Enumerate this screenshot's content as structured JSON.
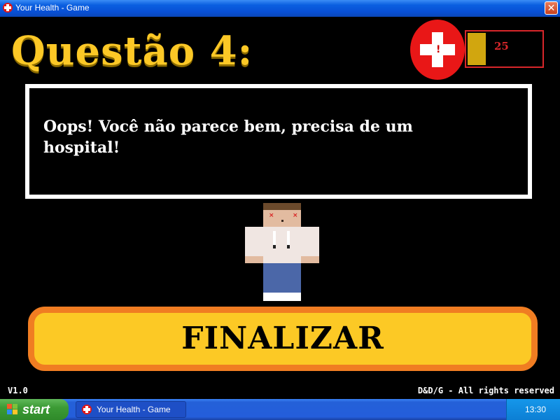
{
  "window": {
    "title": "Your Health - Game",
    "close_symbol": "✕"
  },
  "game": {
    "question_title": "Questão 4:",
    "health": {
      "value": "25",
      "level_percent": 25
    },
    "dialog_text": "Oops! Você não parece bem, precisa de um hospital!",
    "finish_button_label": "FINALIZAR",
    "version": "V1.0",
    "copyright": "D&D/G - All rights reserved"
  },
  "taskbar": {
    "start_label": "start",
    "task_item_label": "Your Health - Game",
    "clock": "13:30"
  },
  "colors": {
    "title_yellow": "#fcc826",
    "health_red": "#e91717",
    "button_fill": "#fcc925",
    "button_border": "#f07d22"
  },
  "icons": [
    "health-cross-icon",
    "close-icon",
    "windows-flag-icon",
    "app-icon"
  ]
}
